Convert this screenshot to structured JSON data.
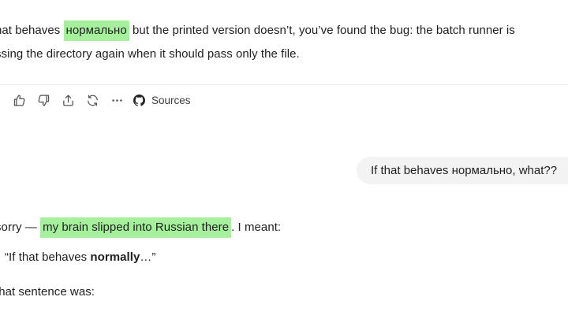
{
  "prev_answer": {
    "line1_before": "hat behaves ",
    "line1_highlight": "нормально",
    "line1_after": " but the printed version doesn’t, you’ve found the bug: the batch runner is",
    "line2": "ssing the directory again when it should pass only the file."
  },
  "toolbar": {
    "thumbs_up_icon": "thumbs-up-icon",
    "thumbs_down_icon": "thumbs-down-icon",
    "share_icon": "share-icon",
    "regenerate_icon": "regenerate-icon",
    "more_icon": "more-icon",
    "sources_label": "Sources"
  },
  "user_message": {
    "text": "If that behaves нормально, what??"
  },
  "answer": {
    "line1_before": "sorry — ",
    "line1_highlight": "my brain slipped into Russian there",
    "line1_after": ". I meant:",
    "quote_before": "“If that behaves ",
    "quote_bold": "normally",
    "quote_after": "…”",
    "line3": " that sentence was:"
  },
  "colors": {
    "highlight": "#a6f09d",
    "bubble": "#f3f3f3",
    "text": "#1f1f1f"
  }
}
